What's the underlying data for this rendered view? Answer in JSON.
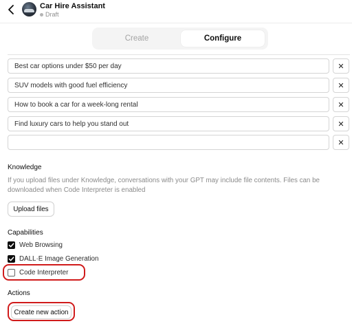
{
  "header": {
    "title": "Car Hire Assistant",
    "status": "Draft"
  },
  "tabs": {
    "create": "Create",
    "configure": "Configure",
    "active": "Configure"
  },
  "conversation_starters": [
    {
      "value": "Best car options under $50 per day",
      "remove": "✕"
    },
    {
      "value": "SUV models with good fuel efficiency",
      "remove": "✕"
    },
    {
      "value": "How to book a car for a week-long rental",
      "remove": "✕"
    },
    {
      "value": "Find luxury cars to help you stand out",
      "remove": "✕"
    },
    {
      "value": "",
      "remove": "✕"
    }
  ],
  "knowledge": {
    "label": "Knowledge",
    "help_line1": "If you upload files under Knowledge, conversations with your GPT may include file contents. Files can be",
    "help_line2": "downloaded when Code Interpreter is enabled",
    "upload_button": "Upload files"
  },
  "capabilities": {
    "label": "Capabilities",
    "items": [
      {
        "label": "Web Browsing",
        "checked": true
      },
      {
        "label": "DALL·E Image Generation",
        "checked": true
      },
      {
        "label": "Code Interpreter",
        "checked": false
      }
    ]
  },
  "actions": {
    "label": "Actions",
    "create_button": "Create new action"
  },
  "annotation_color": "#d01a1a"
}
